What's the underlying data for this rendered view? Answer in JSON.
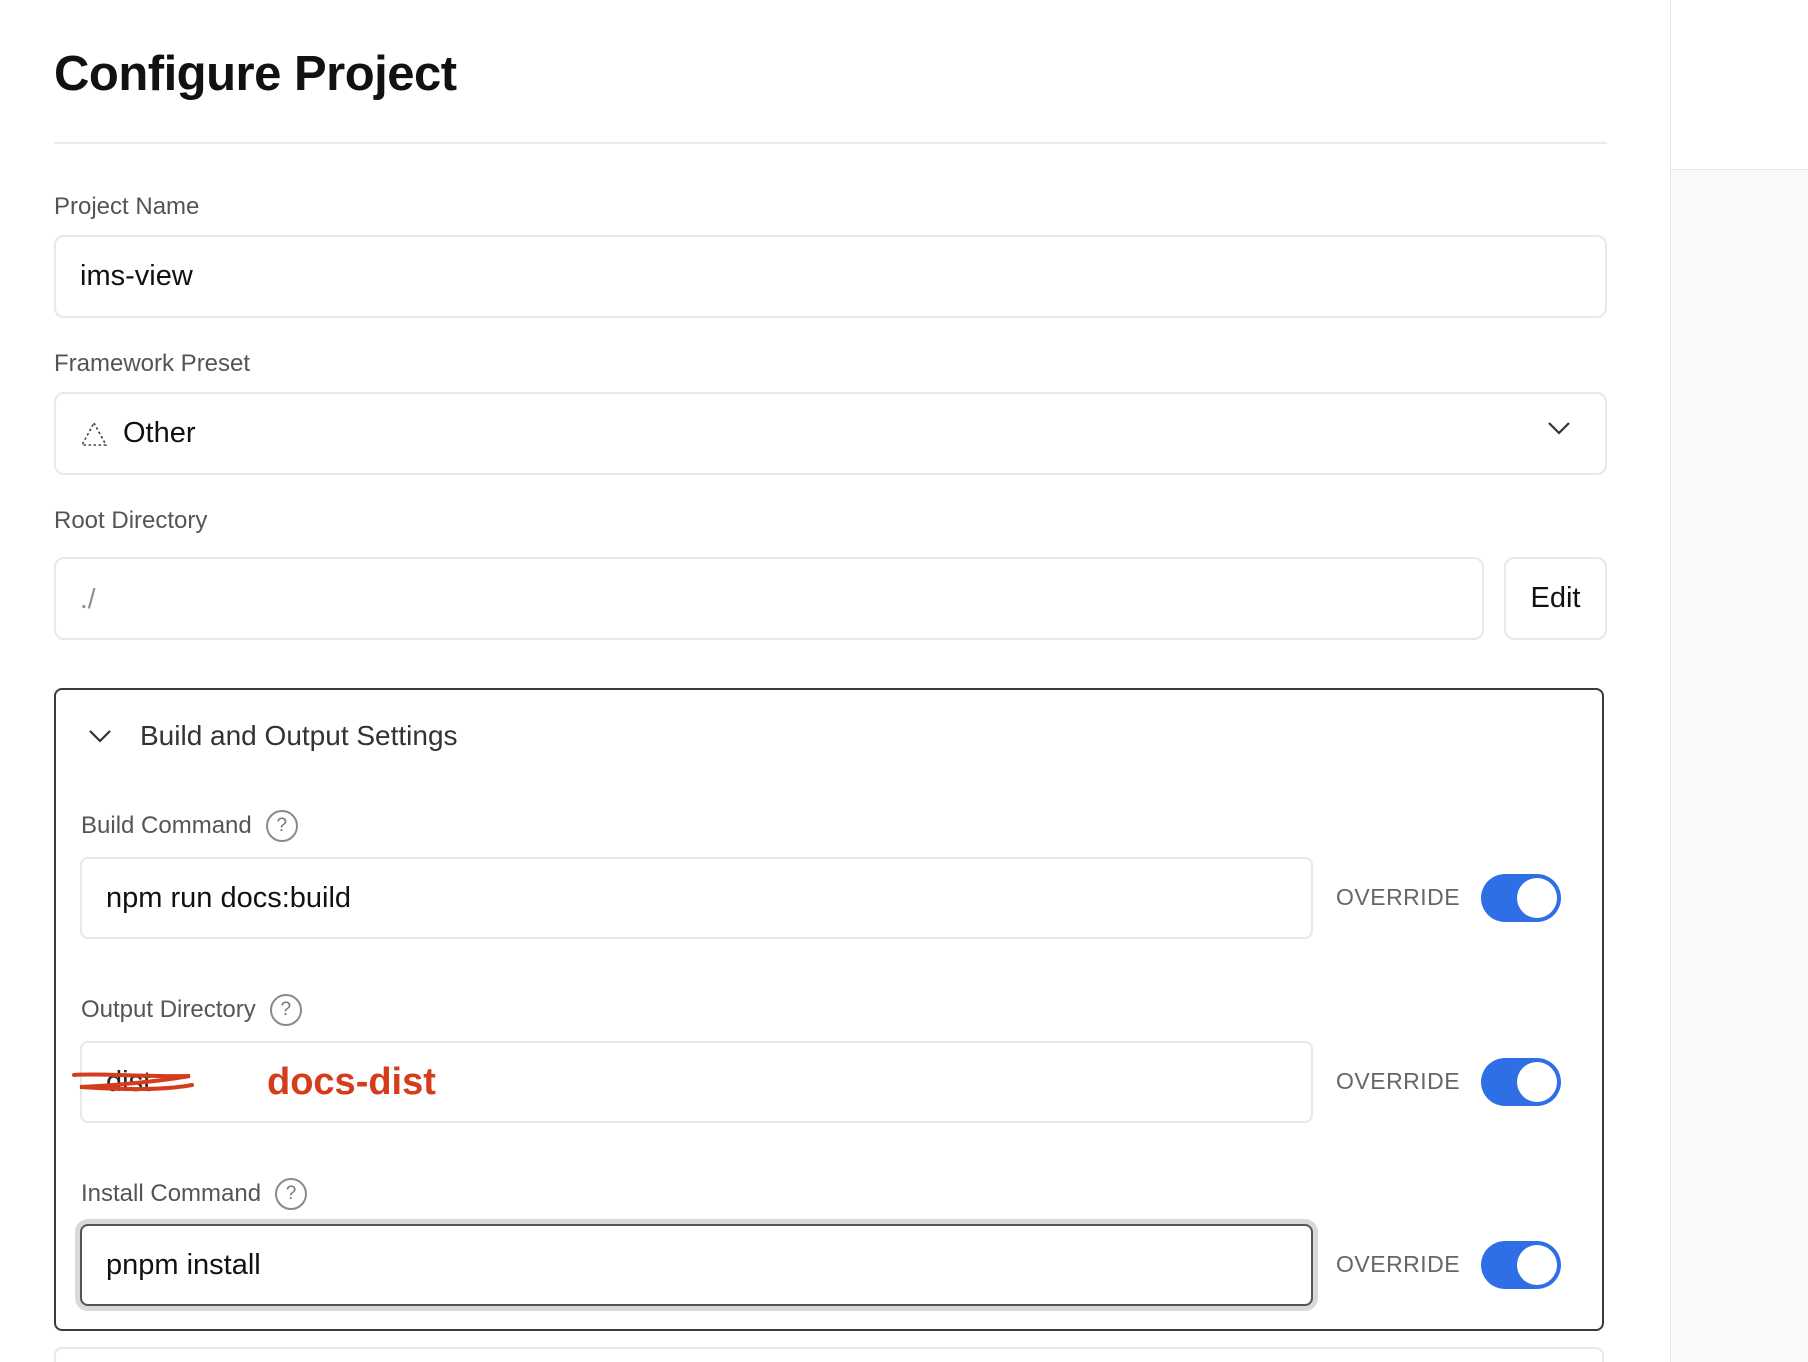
{
  "page_title": "Configure Project",
  "project_name": {
    "label": "Project Name",
    "value": "ims-view"
  },
  "framework": {
    "label": "Framework Preset",
    "value": "Other",
    "icon": "framework-triangle-icon"
  },
  "root_directory": {
    "label": "Root Directory",
    "value": "./",
    "edit_label": "Edit"
  },
  "build_settings": {
    "title": "Build and Output Settings",
    "build_command": {
      "label": "Build Command",
      "help": "?",
      "value": "npm run docs:build",
      "override_label": "OVERRIDE",
      "override_on": true
    },
    "output_directory": {
      "label": "Output Directory",
      "help": "?",
      "value": "dist",
      "annotation": "docs-dist",
      "override_label": "OVERRIDE",
      "override_on": true
    },
    "install_command": {
      "label": "Install Command",
      "help": "?",
      "value": "pnpm install",
      "override_label": "OVERRIDE",
      "override_on": true
    }
  },
  "colors": {
    "toggle_on": "#2f6fe6",
    "annotation": "#d43c1c"
  }
}
